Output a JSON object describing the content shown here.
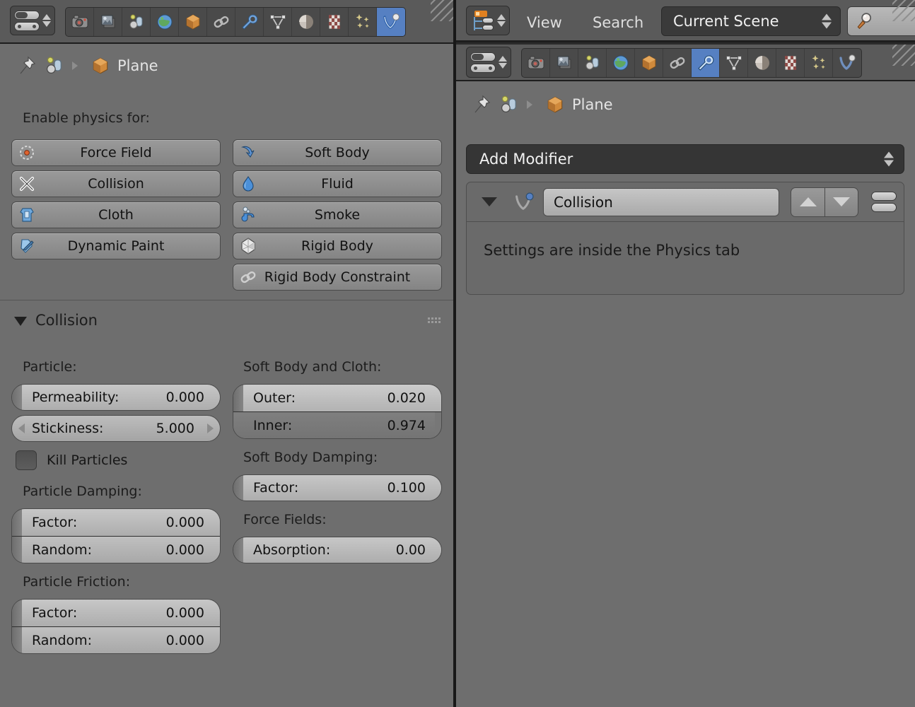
{
  "app": {
    "name": "Blender",
    "theme_bg": "#6e6e6e",
    "accent_blue": "#5680c2",
    "accent_orange": "#e08020"
  },
  "left_area": {
    "editor_type": "properties-editor",
    "tabs": [
      {
        "name": "render",
        "active": false
      },
      {
        "name": "render-layers",
        "active": false
      },
      {
        "name": "scene",
        "active": false
      },
      {
        "name": "world",
        "active": false
      },
      {
        "name": "object",
        "active": false
      },
      {
        "name": "constraints",
        "active": false
      },
      {
        "name": "modifiers",
        "active": false
      },
      {
        "name": "object-data",
        "active": false
      },
      {
        "name": "material",
        "active": false
      },
      {
        "name": "texture",
        "active": false
      },
      {
        "name": "particles",
        "active": false
      },
      {
        "name": "physics",
        "active": true
      }
    ],
    "breadcrumb": {
      "pin": "pin-icon",
      "scene_icon": "scene-icon",
      "object_name": "Plane"
    },
    "enable_physics_label": "Enable physics for:",
    "physics_buttons_left": [
      {
        "label": "Force Field",
        "icon": "force-field-icon"
      },
      {
        "label": "Collision",
        "icon": "collision-icon"
      },
      {
        "label": "Cloth",
        "icon": "cloth-icon"
      },
      {
        "label": "Dynamic Paint",
        "icon": "dynamic-paint-icon"
      }
    ],
    "physics_buttons_right": [
      {
        "label": "Soft Body",
        "icon": "soft-body-icon"
      },
      {
        "label": "Fluid",
        "icon": "fluid-icon"
      },
      {
        "label": "Smoke",
        "icon": "smoke-icon"
      },
      {
        "label": "Rigid Body",
        "icon": "rigid-body-icon"
      },
      {
        "label": "Rigid Body Constraint",
        "icon": "rigid-body-constraint-icon"
      }
    ],
    "collision_panel": {
      "title": "Collision",
      "col_left": {
        "particle_label": "Particle:",
        "permeability": {
          "label": "Permeability:",
          "value": "0.000",
          "fill_pct": 0
        },
        "stickiness": {
          "label": "Stickiness:",
          "value": "5.000",
          "fill_pct": 0
        },
        "kill_particles": {
          "label": "Kill Particles",
          "checked": false
        },
        "particle_damping_label": "Particle Damping:",
        "damping_factor": {
          "label": "Factor:",
          "value": "0.000",
          "fill_pct": 0
        },
        "damping_random": {
          "label": "Random:",
          "value": "0.000",
          "fill_pct": 0
        },
        "particle_friction_label": "Particle Friction:",
        "friction_factor": {
          "label": "Factor:",
          "value": "0.000",
          "fill_pct": 0
        },
        "friction_random": {
          "label": "Random:",
          "value": "0.000",
          "fill_pct": 0
        }
      },
      "col_right": {
        "softbody_cloth_label": "Soft Body and Cloth:",
        "outer": {
          "label": "Outer:",
          "value": "0.020",
          "fill_pct": 96
        },
        "inner": {
          "label": "Inner:",
          "value": "0.974",
          "fill_pct": 97
        },
        "softbody_damping_label": "Soft Body Damping:",
        "damping_factor": {
          "label": "Factor:",
          "value": "0.100",
          "fill_pct": 100
        },
        "force_fields_label": "Force Fields:",
        "absorption": {
          "label": "Absorption:",
          "value": "0.00",
          "fill_pct": 0
        }
      }
    }
  },
  "right_area": {
    "outliner_header": {
      "editor_type": "outliner-editor",
      "menus": [
        "View",
        "Search"
      ],
      "scene_selector": "Current Scene",
      "search_placeholder": ""
    },
    "properties": {
      "editor_type": "properties-editor",
      "tabs": [
        {
          "name": "render",
          "active": false
        },
        {
          "name": "render-layers",
          "active": false
        },
        {
          "name": "scene",
          "active": false
        },
        {
          "name": "world",
          "active": false
        },
        {
          "name": "object",
          "active": false
        },
        {
          "name": "constraints",
          "active": false
        },
        {
          "name": "modifiers",
          "active": true
        },
        {
          "name": "object-data",
          "active": false
        },
        {
          "name": "material",
          "active": false
        },
        {
          "name": "texture",
          "active": false
        },
        {
          "name": "particles",
          "active": false
        },
        {
          "name": "physics",
          "active": false
        }
      ],
      "breadcrumb": {
        "object_name": "Plane"
      },
      "add_modifier_label": "Add Modifier",
      "modifier": {
        "name": "Collision",
        "icon": "collision-modifier-icon",
        "body_text": "Settings are inside the Physics tab"
      }
    }
  }
}
